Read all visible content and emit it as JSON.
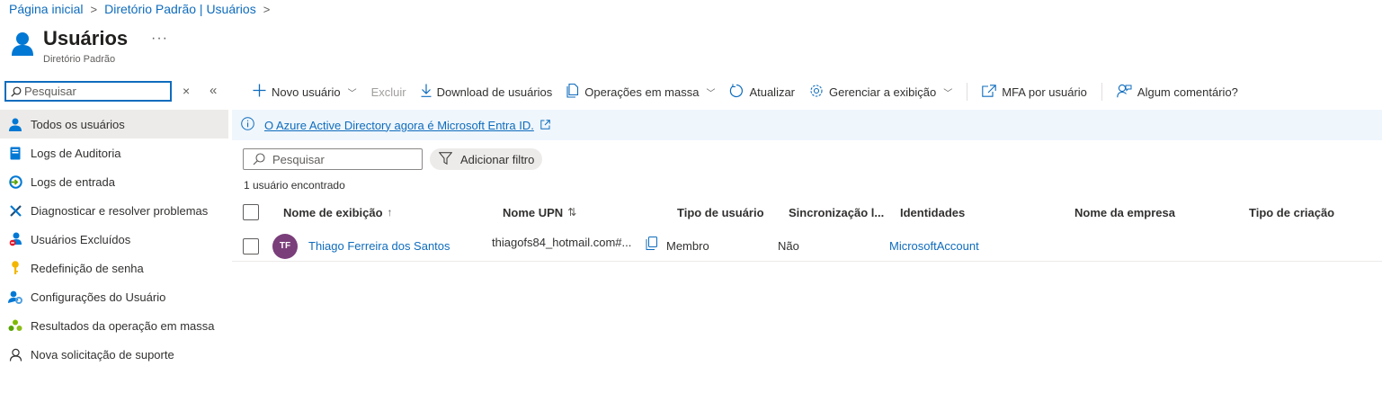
{
  "breadcrumb": {
    "home": "Página inicial",
    "directory": "Diretório Padrão | Usuários",
    "separator": ">"
  },
  "header": {
    "title": "Usuários",
    "subtitle": "Diretório Padrão",
    "more": "···"
  },
  "left_search": {
    "placeholder": "Pesquisar",
    "clear": "×",
    "collapse": "«"
  },
  "sidebar": {
    "items": [
      {
        "label": "Todos os usuários",
        "icon": "user-icon",
        "active": true
      },
      {
        "label": "Logs de Auditoria",
        "icon": "audit-log-icon"
      },
      {
        "label": "Logs de entrada",
        "icon": "sign-in-log-icon"
      },
      {
        "label": "Diagnosticar e resolver problemas",
        "icon": "wrench-icon"
      },
      {
        "label": "Usuários Excluídos",
        "icon": "deleted-user-icon"
      },
      {
        "label": "Redefinição de senha",
        "icon": "key-icon"
      },
      {
        "label": "Configurações do Usuário",
        "icon": "user-settings-icon"
      },
      {
        "label": "Resultados da operação em massa",
        "icon": "bulk-results-icon"
      },
      {
        "label": "Nova solicitação de suporte",
        "icon": "support-icon"
      }
    ]
  },
  "toolbar": {
    "new_user": "Novo usuário",
    "delete": "Excluir",
    "download": "Download de usuários",
    "bulk": "Operações em massa",
    "refresh": "Atualizar",
    "manage_view": "Gerenciar a exibição",
    "mfa": "MFA por usuário",
    "feedback": "Algum comentário?"
  },
  "banner": {
    "text": "O Azure Active Directory agora é Microsoft Entra ID."
  },
  "main_search": {
    "placeholder": "Pesquisar"
  },
  "filter": {
    "label": "Adicionar filtro"
  },
  "result_count": "1 usuário encontrado",
  "table": {
    "columns": {
      "display_name": "Nome de exibição",
      "upn": "Nome UPN",
      "user_type": "Tipo de usuário",
      "sync": "Sincronização l...",
      "identities": "Identidades",
      "company": "Nome da empresa",
      "creation": "Tipo de criação"
    },
    "sort_asc": "↑",
    "sort_both": "⇅",
    "rows": [
      {
        "initials": "TF",
        "display_name": "Thiago Ferreira dos Santos",
        "upn": "thiagofs84_hotmail.com#...",
        "user_type": "Membro",
        "sync": "Não",
        "identities": "MicrosoftAccount",
        "company": "",
        "creation": ""
      }
    ]
  },
  "colors": {
    "accent": "#0f6cbd",
    "avatar": "#7a3e7a",
    "banner_bg": "#eff6fc",
    "active_bg": "#edebe9"
  }
}
